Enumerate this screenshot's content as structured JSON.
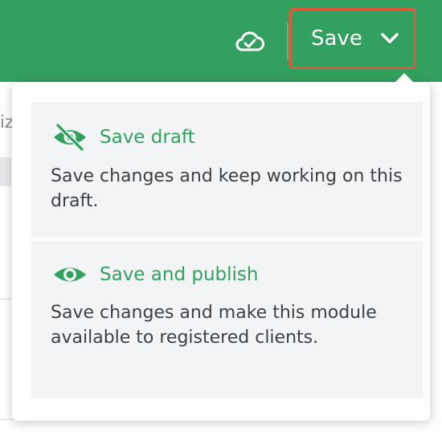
{
  "header": {
    "cloud_icon": "cloud-check-icon",
    "save_button": {
      "label": "Save",
      "chevron_icon": "chevron-down-icon"
    }
  },
  "background": {
    "fragment_text": "iz"
  },
  "menu": {
    "items": [
      {
        "icon": "eye-slash-icon",
        "title": "Save draft",
        "description": "Save changes and keep working on this draft."
      },
      {
        "icon": "eye-icon",
        "title": "Save and publish",
        "description": "Save changes and make this module available to registered clients."
      }
    ]
  },
  "colors": {
    "header_green": "#32a05f",
    "accent_green": "#32a05f",
    "highlight_border": "#e35a3a",
    "text_dark": "#3a4147"
  }
}
